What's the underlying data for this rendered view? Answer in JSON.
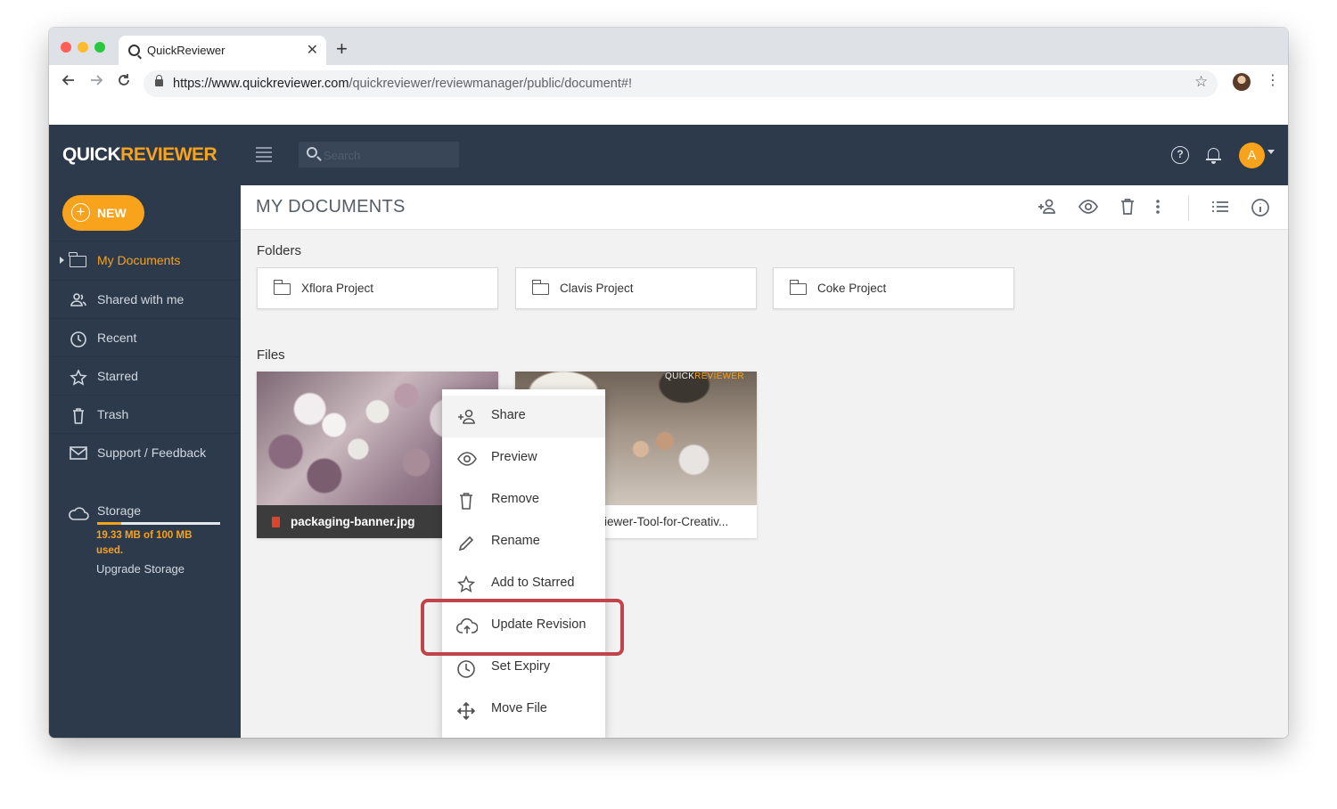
{
  "browser": {
    "tab_title": "QuickReviewer",
    "url_host": "https://www.quickreviewer.com",
    "url_path": "/quickreviewer/reviewmanager/public/document#!",
    "colors": {
      "close": "#ff5f57",
      "minimize": "#febc2e",
      "maximize": "#28c840"
    },
    "icons": [
      "back-icon",
      "forward-icon",
      "reload-icon",
      "lock-icon",
      "bookmark-star-icon",
      "chrome-menu-icon"
    ]
  },
  "app": {
    "logo_part1": "QUICK",
    "logo_part2": "REVIEWER",
    "search_placeholder": "Search",
    "avatar_letter": "A",
    "brand_color": "#f8a31b",
    "nav_color": "#2d3a4b"
  },
  "sidebar": {
    "new_label": "NEW",
    "items": [
      {
        "label": "My Documents",
        "icon": "folder-icon",
        "active": true
      },
      {
        "label": "Shared with me",
        "icon": "people-icon"
      },
      {
        "label": "Recent",
        "icon": "clock-icon"
      },
      {
        "label": "Starred",
        "icon": "star-icon"
      },
      {
        "label": "Trash",
        "icon": "trash-icon"
      },
      {
        "label": "Support / Feedback",
        "icon": "mail-icon"
      }
    ],
    "storage": {
      "label": "Storage",
      "used_text": "19.33 MB of 100 MB used.",
      "used_fraction": 0.1933,
      "upgrade_label": "Upgrade Storage"
    }
  },
  "main": {
    "title": "MY DOCUMENTS",
    "header_icons": [
      "add-user-icon",
      "eye-icon",
      "trash-icon",
      "more-vertical-icon",
      "list-view-icon",
      "info-icon"
    ],
    "folders_label": "Folders",
    "folders": [
      {
        "name": "Xflora Project"
      },
      {
        "name": "Clavis Project"
      },
      {
        "name": "Coke Project"
      }
    ],
    "files_label": "Files",
    "files": [
      {
        "name": "packaging-banner.jpg",
        "type": "jpg"
      },
      {
        "name": "iewer-Tool-for-Creativ...",
        "brand_part1": "QUICK",
        "brand_part2": "REVIEWER"
      }
    ]
  },
  "context_menu": {
    "items": [
      {
        "label": "Share",
        "icon": "share-user-icon"
      },
      {
        "label": "Preview",
        "icon": "eye-icon"
      },
      {
        "label": "Remove",
        "icon": "trash-icon"
      },
      {
        "label": "Rename",
        "icon": "pencil-icon"
      },
      {
        "label": "Add to Starred",
        "icon": "star-icon"
      },
      {
        "label": "Update Revision",
        "icon": "cloud-upload-icon",
        "highlighted": true
      },
      {
        "label": "Set Expiry",
        "icon": "clock-icon"
      },
      {
        "label": "Move File",
        "icon": "move-icon"
      }
    ],
    "highlight_color": "#c0454a"
  }
}
